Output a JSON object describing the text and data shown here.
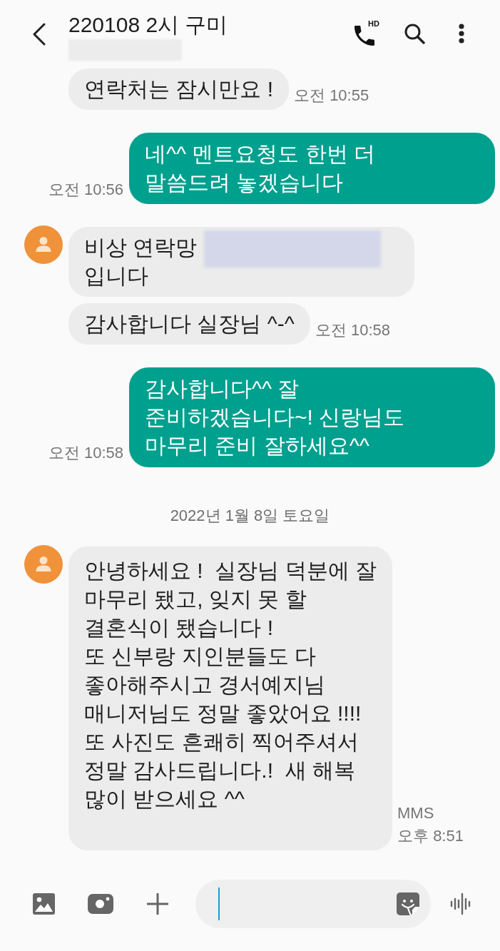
{
  "header": {
    "title": "220108 2시 구미",
    "subtitle_redacted": true,
    "call_badge": "HD"
  },
  "messages": [
    {
      "kind": "incoming",
      "show_avatar": false,
      "text": "연락처는 잠시만요 !",
      "time": "오전 10:55"
    },
    {
      "kind": "outgoing",
      "text": "네^^ 멘트요청도 한번 더\n말씀드려 놓겠습니다",
      "time": "오전 10:56"
    },
    {
      "kind": "incoming",
      "show_avatar": true,
      "text": "비상 연락망",
      "redacted": true,
      "text_after": "입니다"
    },
    {
      "kind": "incoming",
      "show_avatar": false,
      "text": "감사합니다 실장님 ^-^",
      "time": "오전 10:58"
    },
    {
      "kind": "outgoing",
      "text": "감사합니다^^ 잘\n준비하겠습니다~! 신랑님도\n마무리 준비 잘하세요^^",
      "time": "오전 10:58"
    },
    {
      "kind": "date",
      "text": "2022년 1월 8일 토요일"
    },
    {
      "kind": "incoming",
      "show_avatar": true,
      "text": "안녕하세요 !  실장님 덕분에 잘\n마무리 됐고, 잊지 못 할\n결혼식이 됐습니다 !\n또 신부랑 지인분들도 다\n좋아해주시고 경서예지님\n매니저님도 정말 좋았어요 !!!!\n또 사진도 흔쾌히 찍어주셔서\n정말 감사드립니다.!  새 해복\n많이 받으세요 ^^",
      "label": "MMS",
      "time": "오후 8:51"
    }
  ]
}
